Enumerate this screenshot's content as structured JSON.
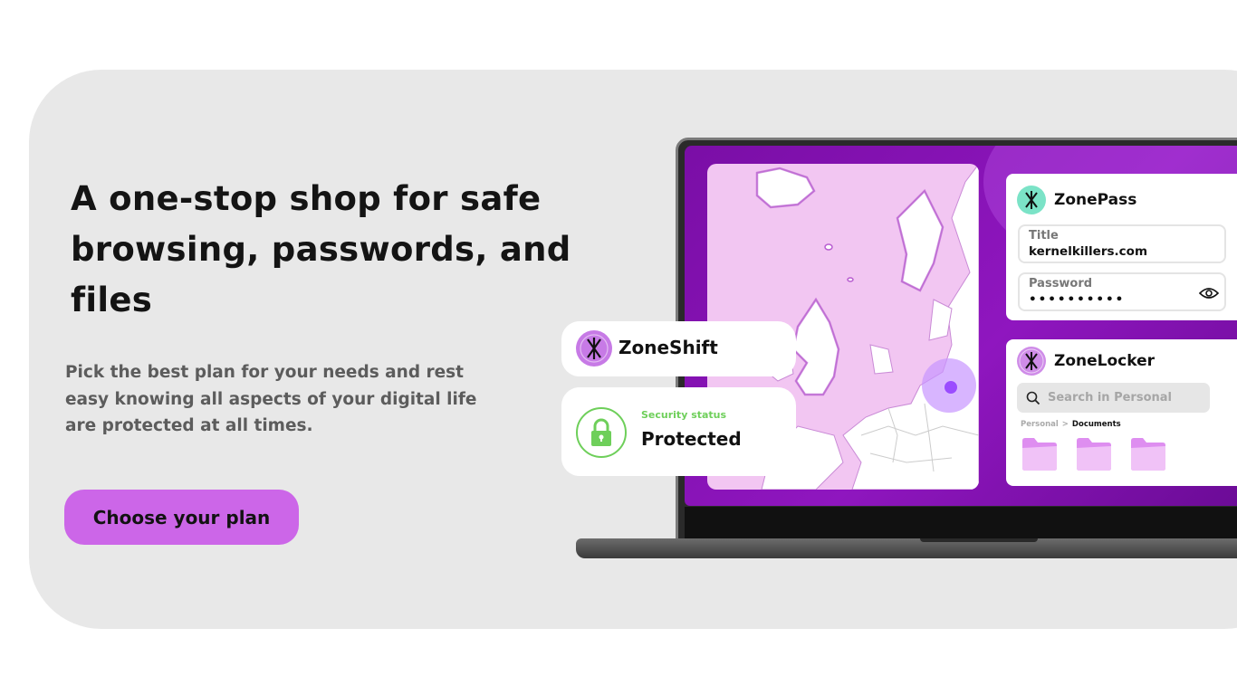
{
  "hero": {
    "headline": "A one-stop shop for safe browsing, passwords, and files",
    "subtext": "Pick the best plan for your needs and rest easy knowing all aspects of your digital life are protected at all times.",
    "cta_label": "Choose your plan"
  },
  "zoneshift": {
    "title": "ZoneShift",
    "icon": "zoneshift-logo-icon"
  },
  "security": {
    "label": "Security status",
    "value": "Protected",
    "icon": "lock-icon",
    "color": "#6ecf5a"
  },
  "zonepass": {
    "title": "ZonePass",
    "icon": "zonepass-logo-icon",
    "title_field_label": "Title",
    "title_field_value": "kernelkillers.com",
    "password_field_label": "Password",
    "password_field_value": "••••••••••"
  },
  "zonelocker": {
    "title": "ZoneLocker",
    "icon": "zonelocker-logo-icon",
    "search_placeholder": "Search in Personal",
    "breadcrumb_root": "Personal",
    "breadcrumb_sep": ">",
    "breadcrumb_current": "Documents",
    "folders": [
      "folder-icon",
      "folder-icon",
      "folder-icon"
    ]
  },
  "colors": {
    "accent": "#cc66e8",
    "screen": "#8f16bf",
    "map_land": "#f2c6f2",
    "background": "#e8e8e8"
  }
}
